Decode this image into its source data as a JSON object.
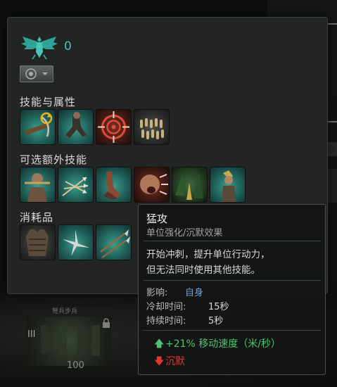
{
  "emblem": {
    "icon": "eagle-emblem-icon",
    "count": "0"
  },
  "formation": {
    "icon": "formation-toggle-icon"
  },
  "sections": {
    "skills_label": "技能与属性",
    "optional_label": "可选额外技能",
    "consumables_label": "消耗品"
  },
  "skills": [
    {
      "name": "crossbow-reload",
      "icon": "crossbow-icon"
    },
    {
      "name": "sprint",
      "icon": "running-soldier-icon"
    },
    {
      "name": "target",
      "icon": "target-icon"
    },
    {
      "name": "ammo",
      "icon": "bolts-icon"
    }
  ],
  "optional_skills": [
    {
      "name": "warrior",
      "icon": "warrior-icon"
    },
    {
      "name": "arrows",
      "icon": "arrows-icon"
    },
    {
      "name": "charge-feet",
      "icon": "running-feet-icon"
    },
    {
      "name": "roar",
      "icon": "roaring-soldier-icon"
    },
    {
      "name": "jungle-march",
      "icon": "jungle-icon"
    },
    {
      "name": "archer",
      "icon": "archer-icon"
    }
  ],
  "consumables": [
    {
      "name": "armor",
      "icon": "armor-vest-icon"
    },
    {
      "name": "caltrops",
      "icon": "caltrops-icon"
    },
    {
      "name": "spears",
      "icon": "spears-icon"
    }
  ],
  "unit": {
    "title": "弩兵步兵",
    "rank": "III",
    "count": "100"
  },
  "tooltip": {
    "title": "猛攻",
    "subtitle": "单位强化/沉默效果",
    "desc_line1": "开始冲刺，提升单位行动力，",
    "desc_line2": "但无法同时使用其他技能。",
    "effect_label": "影响:",
    "effect_value": "自身",
    "cooldown_label": "冷却时间:",
    "cooldown_value": "15秒",
    "duration_label": "持续时间:",
    "duration_value": "5秒",
    "buff_text": "+21% 移动速度（米/秒）",
    "debuff_text": "沉默",
    "colors": {
      "buff": "#4ec46e",
      "debuff": "#e2382e",
      "highlight": "#5aa7e8"
    }
  }
}
